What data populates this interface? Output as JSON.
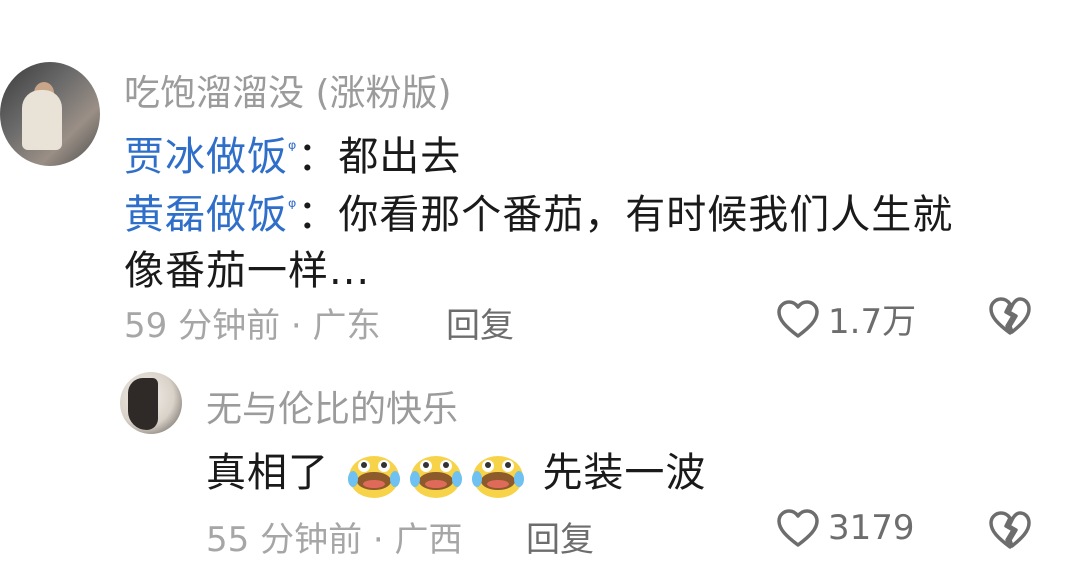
{
  "comment1": {
    "username": "吃饱溜溜没 (涨粉版)",
    "line1": {
      "mention": "贾冰做饭",
      "search_mark": "ᵠ",
      "colon": "：",
      "text": "都出去"
    },
    "line2": {
      "mention": "黄磊做饭",
      "search_mark": "ᵠ",
      "colon": "：",
      "text": "你看那个番茄，有时候我们人生就"
    },
    "line3": "像番茄一样...",
    "meta": "59 分钟前 · 广东",
    "reply_label": "回复",
    "like_count": "1.7万"
  },
  "comment2": {
    "username": "无与伦比的快乐",
    "text_before": "真相了",
    "emoji_names": [
      "crying-laughing-emoji",
      "crying-laughing-emoji",
      "crying-laughing-emoji"
    ],
    "text_after": "先装一波",
    "meta": "55 分钟前 · 广西",
    "reply_label": "回复",
    "like_count": "3179"
  },
  "colors": {
    "mention": "#2f6fc9",
    "meta": "#a6a6a6",
    "username": "#9b9b9b"
  }
}
